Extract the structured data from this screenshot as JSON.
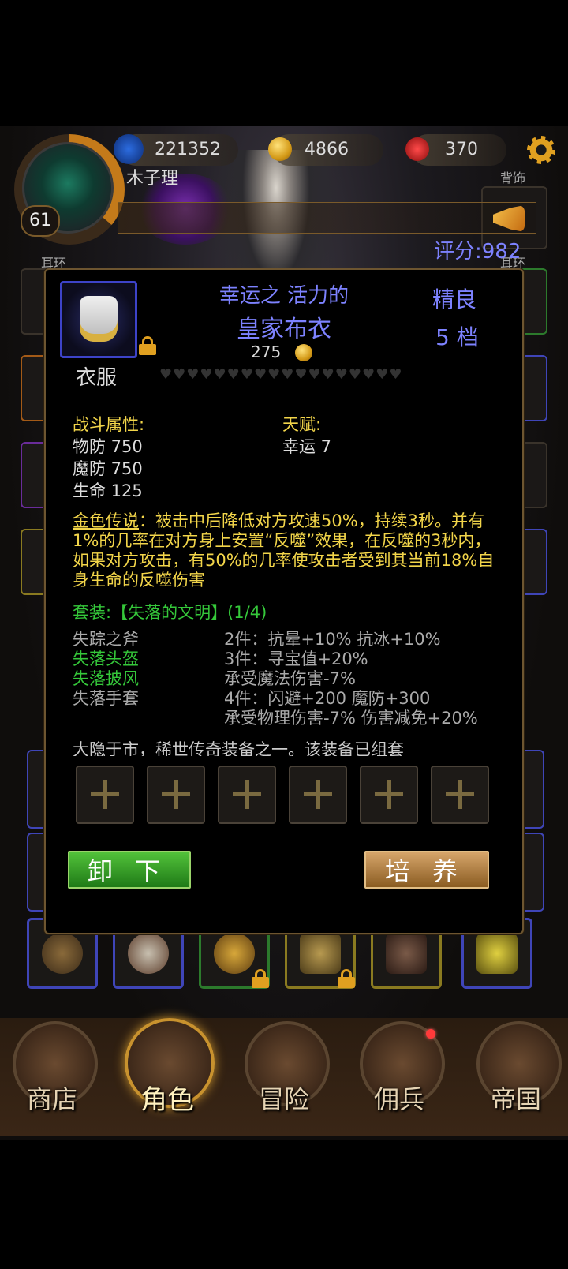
{
  "header": {
    "level": "61",
    "player_name": "木子理",
    "resources": {
      "gems": "221352",
      "gold": "4866",
      "crystals": "370"
    },
    "score": "评分:982",
    "slot_labels": {
      "back": "背饰",
      "earring_left": "耳环",
      "earring_right": "耳环"
    }
  },
  "item": {
    "prefix": "幸运之 活力的",
    "name": "皇家布衣",
    "price": "275",
    "quality": "精良",
    "grade": "5 档",
    "slot_type": "衣服",
    "hearts": "♥♥♥♥♥♥♥♥♥♥♥♥♥♥♥♥♥♥",
    "combat_title": "战斗属性:",
    "combat_stats": [
      "物防 750",
      "魔防 750",
      "生命 125"
    ],
    "talent_title": "天赋:",
    "talent_stats": [
      "幸运 7"
    ],
    "legend_label": "金色传说",
    "legend_text": "：被击中后降低对方攻速50%，持续3秒。并有1%的几率在对方身上安置“反噬”效果，在反噬的3秒内，如果对方攻击，有50%的几率使攻击者受到其当前18%自身生命的反噬伤害",
    "set_title": "套装:【失落的文明】(1/4)",
    "set_items": [
      {
        "name": "失踪之斧",
        "owned": false
      },
      {
        "name": "失落头盔",
        "owned": true
      },
      {
        "name": "失落披风",
        "owned": true
      },
      {
        "name": "失落手套",
        "owned": false
      }
    ],
    "set_bonuses": [
      "2件：抗晕+10% 抗冰+10%",
      "3件：寻宝值+20%",
      "承受魔法伤害-7%",
      "4件：闪避+200 魔防+300",
      "承受物理伤害-7% 伤害减免+20%"
    ],
    "flavor": "大隐于市，稀世传奇装备之一。该装备已组套"
  },
  "buttons": {
    "unequip": "卸下",
    "train": "培养"
  },
  "nav": {
    "items": [
      {
        "label": "商店",
        "icon": "shop-icon"
      },
      {
        "label": "角色",
        "icon": "character-icon"
      },
      {
        "label": "冒险",
        "icon": "adventure-icon"
      },
      {
        "label": "佣兵",
        "icon": "mercenary-icon"
      },
      {
        "label": "帝国",
        "icon": "empire-icon"
      }
    ],
    "active_index": 1
  },
  "colors": {
    "item_name": "#7d82ff",
    "legend": "#f2d54a",
    "set_owned": "#35c83a",
    "set_missing": "#aaaaaa",
    "unequip_button": "#3aa82a",
    "train_button": "#c08a45"
  }
}
